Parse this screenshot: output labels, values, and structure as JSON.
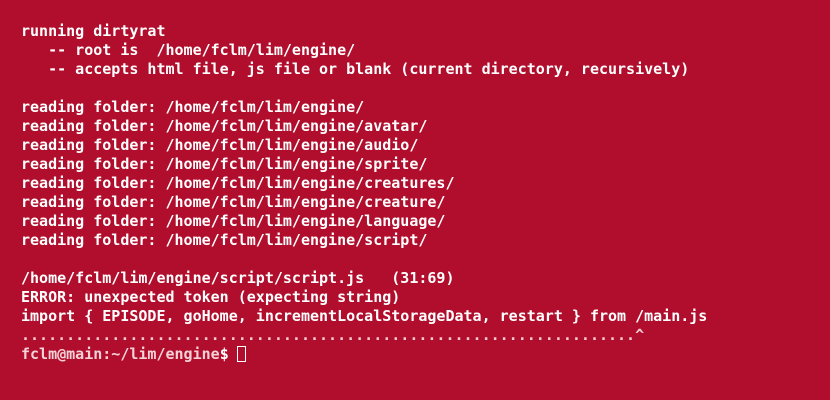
{
  "header": {
    "running": "running dirtyrat",
    "root": "   -- root is  /home/fclm/lim/engine/",
    "accepts": "   -- accepts html file, js file or blank (current directory, recursively)"
  },
  "folders": [
    "reading folder: /home/fclm/lim/engine/",
    "reading folder: /home/fclm/lim/engine/avatar/",
    "reading folder: /home/fclm/lim/engine/audio/",
    "reading folder: /home/fclm/lim/engine/sprite/",
    "reading folder: /home/fclm/lim/engine/creatures/",
    "reading folder: /home/fclm/lim/engine/creature/",
    "reading folder: /home/fclm/lim/engine/language/",
    "reading folder: /home/fclm/lim/engine/script/"
  ],
  "error": {
    "location": "/home/fclm/lim/engine/script/script.js   (31:69)",
    "message": "ERROR: unexpected token (expecting string)",
    "source": "import { EPISODE, goHome, incrementLocalStorageData, restart } from /main.js",
    "marker": "....................................................................^"
  },
  "prompt": {
    "user_host": "fclm@main",
    "path": ":~/lim/engine",
    "symbol": "$"
  },
  "colors": {
    "background": "#b00e2c",
    "text": "#ffffff"
  }
}
